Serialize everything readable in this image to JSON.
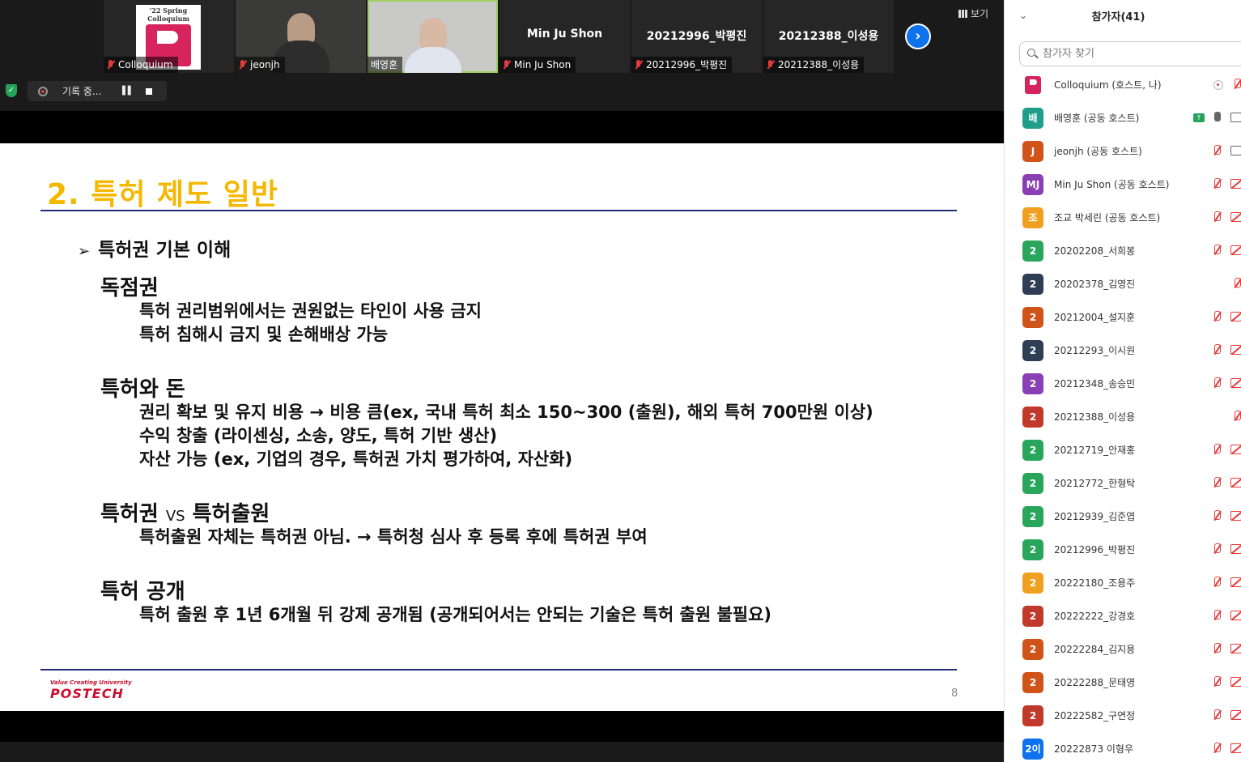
{
  "colors": {
    "slide_title": "#f5b800",
    "rule": "#1f2a78",
    "accent_blue": "#0e72ed",
    "mute_red": "#e23b3b",
    "secure_green": "#23a45a",
    "postech_red": "#c8102e"
  },
  "video_strip": {
    "tiles": [
      {
        "id": "colloquium",
        "name": "Colloquium",
        "logo_text": "'22 Spring Colloquium",
        "muted": true
      },
      {
        "id": "jeonjh",
        "name": "jeonjh",
        "muted": true
      },
      {
        "id": "baeyounghoon",
        "name": "배영훈",
        "muted": false,
        "active": true
      },
      {
        "id": "minjushon",
        "name": "Min Ju Shon",
        "display_name": "Min Ju Shon",
        "muted": true
      },
      {
        "id": "20212996",
        "name": "20212996_박평진",
        "display_name": "20212996_박평진",
        "muted": true
      },
      {
        "id": "20212388",
        "name": "20212388_이성용",
        "display_name": "20212388_이성용",
        "muted": true
      }
    ],
    "next_icon": "chevron-right-icon",
    "view_label": "보기"
  },
  "recording": {
    "label": "기록 중...",
    "status_icon": "record-icon"
  },
  "slide": {
    "title": "2. 특허 제도 일반",
    "bullet": "특허권 기본 이해",
    "sections": [
      {
        "title": "독점권",
        "lines": [
          "특허 권리범위에서는 권원없는 타인이 사용 금지",
          "특허 침해시 금지 및 손해배상 가능"
        ]
      },
      {
        "title": "특허와 돈",
        "lines": [
          "권리 확보 및 유지 비용 → 비용 큼(ex, 국내 특허 최소 150~300 (출원), 해외 특허 700만원 이상)",
          "수익 창출 (라이센싱, 소송, 양도, 특허 기반 생산)",
          "자산 가능 (ex, 기업의 경우, 특허권 가치 평가하여, 자산화)"
        ]
      },
      {
        "title_a": "특허권",
        "title_vs": "VS",
        "title_b": "특허출원",
        "lines": [
          "특허출원 자체는 특허권 아님. → 특허청 심사 후 등록 후에 특허권 부여"
        ]
      },
      {
        "title": "특허 공개",
        "lines": [
          "특허 출원 후 1년 6개월 뒤 강제 공개됨 (공개되어서는 안되는 기술은 특허 출원 불필요)"
        ]
      }
    ],
    "logo_tagline": "Value Creating University",
    "logo_word": "POSTECH",
    "page_number": "8"
  },
  "participants": {
    "title": "참가자(41)",
    "search_placeholder": "참가자 찾기",
    "list": [
      {
        "avatar": "",
        "avatar_color": "#ffffff",
        "is_logo": true,
        "name": "Colloquium (호스트, 나)",
        "mic": "muted",
        "cam": "none",
        "host_dot": true
      },
      {
        "avatar": "배",
        "avatar_color": "#1f9e8a",
        "name": "배영훈 (공동 호스트)",
        "mic": "on",
        "cam": "on",
        "sharing": true
      },
      {
        "avatar": "J",
        "avatar_color": "#d0531a",
        "name": "jeonjh (공동 호스트)",
        "mic": "muted",
        "cam": "on"
      },
      {
        "avatar": "MJ",
        "avatar_color": "#8a3fb5",
        "name": "Min Ju Shon (공동 호스트)",
        "mic": "muted",
        "cam": "off"
      },
      {
        "avatar": "조",
        "avatar_color": "#f0a020",
        "name": "조교 박세린 (공동 호스트)",
        "mic": "muted",
        "cam": "off"
      },
      {
        "avatar": "2",
        "avatar_color": "#2aa65c",
        "name": "20202208_서희봉",
        "mic": "muted",
        "cam": "off"
      },
      {
        "avatar": "2",
        "avatar_color": "#2f3e55",
        "name": "20202378_김영진",
        "mic": "muted",
        "cam": "none"
      },
      {
        "avatar": "2",
        "avatar_color": "#d0531a",
        "name": "20212004_설지훈",
        "mic": "muted",
        "cam": "off"
      },
      {
        "avatar": "2",
        "avatar_color": "#2f3e55",
        "name": "20212293_이시원",
        "mic": "muted",
        "cam": "off"
      },
      {
        "avatar": "2",
        "avatar_color": "#8a3fb5",
        "name": "20212348_송승민",
        "mic": "muted",
        "cam": "off"
      },
      {
        "avatar": "2",
        "avatar_color": "#c0392b",
        "name": "20212388_이성용",
        "mic": "muted",
        "cam": "none"
      },
      {
        "avatar": "2",
        "avatar_color": "#2aa65c",
        "name": "20212719_안재홍",
        "mic": "muted",
        "cam": "off"
      },
      {
        "avatar": "2",
        "avatar_color": "#2aa65c",
        "name": "20212772_한형탁",
        "mic": "muted",
        "cam": "off"
      },
      {
        "avatar": "2",
        "avatar_color": "#2aa65c",
        "name": "20212939_김준엽",
        "mic": "muted",
        "cam": "off"
      },
      {
        "avatar": "2",
        "avatar_color": "#2aa65c",
        "name": "20212996_박평진",
        "mic": "muted",
        "cam": "off"
      },
      {
        "avatar": "2",
        "avatar_color": "#f0a020",
        "name": "20222180_조용주",
        "mic": "muted",
        "cam": "off"
      },
      {
        "avatar": "2",
        "avatar_color": "#c0392b",
        "name": "20222222_강경호",
        "mic": "muted",
        "cam": "off"
      },
      {
        "avatar": "2",
        "avatar_color": "#d0531a",
        "name": "20222284_김지용",
        "mic": "muted",
        "cam": "off"
      },
      {
        "avatar": "2",
        "avatar_color": "#d0531a",
        "name": "20222288_문태영",
        "mic": "muted",
        "cam": "off"
      },
      {
        "avatar": "2",
        "avatar_color": "#c0392b",
        "name": "20222582_구연정",
        "mic": "muted",
        "cam": "off"
      },
      {
        "avatar": "2이",
        "avatar_color": "#0e72ed",
        "name": "20222873 이형우",
        "mic": "muted",
        "cam": "off"
      }
    ]
  }
}
